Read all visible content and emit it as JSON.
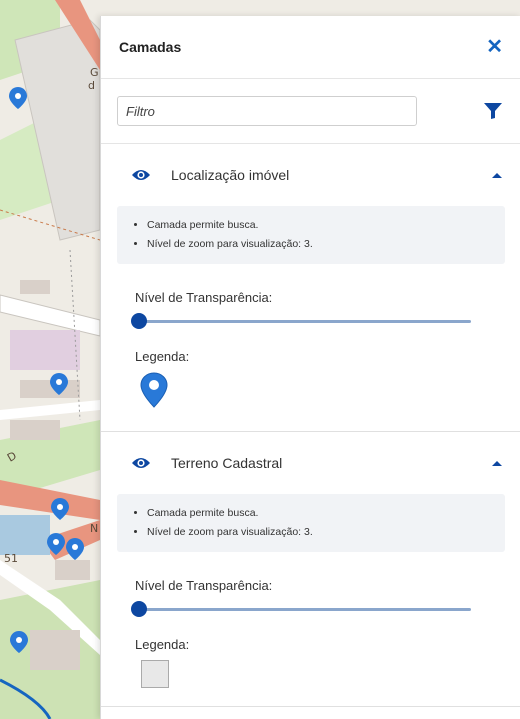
{
  "panel": {
    "title": "Camadas",
    "close_icon": "close-icon",
    "filter": {
      "placeholder": "Filtro",
      "value": ""
    },
    "filter_icon": "funnel-icon"
  },
  "layers": [
    {
      "name": "Localização imóvel",
      "visible_icon": "eye-icon",
      "expanded_icon": "caret-up-icon",
      "info": [
        "Camada permite busca.",
        "Nível de zoom para visualização: 3."
      ],
      "transparency_label": "Nível de Transparência:",
      "transparency": 0,
      "legend_label": "Legenda:",
      "legend_icon": "map-pin-icon"
    },
    {
      "name": "Terreno Cadastral",
      "visible_icon": "eye-icon",
      "expanded_icon": "caret-up-icon",
      "info": [
        "Camada permite busca.",
        "Nível de zoom para visualização: 3."
      ],
      "transparency_label": "Nível de Transparência:",
      "transparency": 0,
      "legend_label": "Legenda:",
      "legend_icon": "gray-square-icon"
    }
  ],
  "map": {
    "labels": [
      "G",
      "d",
      "D",
      "N",
      "51"
    ],
    "marker_icon": "map-pin-icon",
    "colors": {
      "marker": "#2979d8",
      "road": "#e8957f",
      "green": "#cfe6b8",
      "building": "#d9d0c9"
    }
  },
  "colors": {
    "accent": "#1565c0",
    "slider_track": "#8aa6cc",
    "slider_thumb": "#0d47a1"
  }
}
